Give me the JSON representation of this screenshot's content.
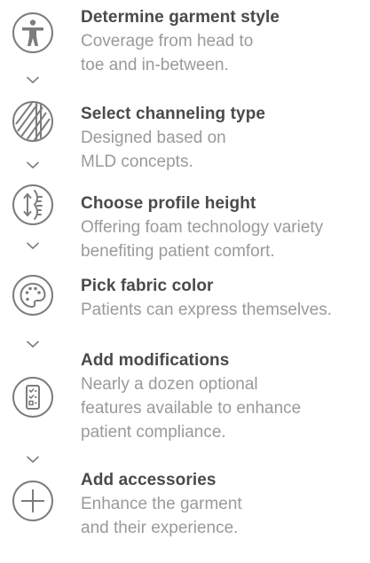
{
  "steps": [
    {
      "icon": "person-icon",
      "title": "Determine garment style",
      "description": "Coverage from head to\ntoe and in-between."
    },
    {
      "icon": "channeling-icon",
      "title": "Select channeling type",
      "description": "Designed based on\nMLD concepts."
    },
    {
      "icon": "profile-height-icon",
      "title": "Choose profile height",
      "description": "Offering foam technology variety\nbenefiting patient comfort."
    },
    {
      "icon": "palette-icon",
      "title": "Pick fabric color",
      "description": "Patients can express themselves."
    },
    {
      "icon": "checklist-icon",
      "title": "Add modifications",
      "description": "Nearly a dozen optional\nfeatures available to enhance\npatient compliance."
    },
    {
      "icon": "plus-icon",
      "title": "Add accessories",
      "description": "Enhance the garment\nand their experience."
    }
  ],
  "colors": {
    "icon": "#7c7c7c",
    "title": "#4a4a4a",
    "description": "#9a9a9a"
  }
}
